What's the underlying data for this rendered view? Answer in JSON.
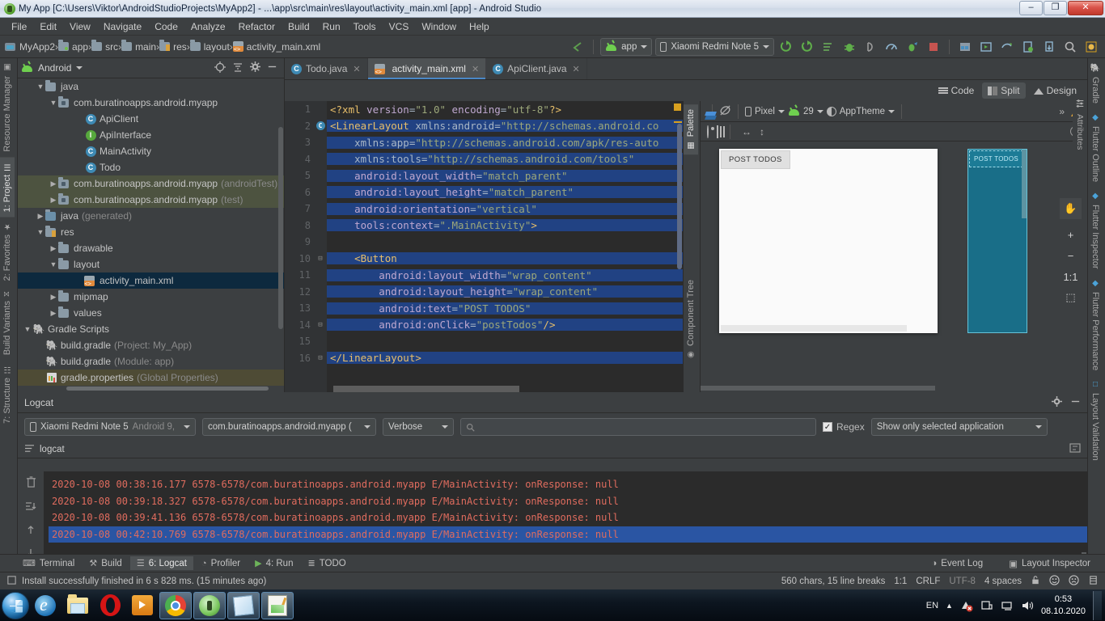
{
  "window": {
    "title": "My App [C:\\Users\\Viktor\\AndroidStudioProjects\\MyApp2] - ...\\app\\src\\main\\res\\layout\\activity_main.xml [app] - Android Studio",
    "minimize": "–",
    "maximize": "❐",
    "close": "✕"
  },
  "menu": [
    "File",
    "Edit",
    "View",
    "Navigate",
    "Code",
    "Analyze",
    "Refactor",
    "Build",
    "Run",
    "Tools",
    "VCS",
    "Window",
    "Help"
  ],
  "breadcrumb": [
    {
      "label": "MyApp2",
      "icon": "project-icon"
    },
    {
      "label": "app",
      "icon": "module-folder-icon"
    },
    {
      "label": "src",
      "icon": "folder-icon"
    },
    {
      "label": "main",
      "icon": "folder-icon"
    },
    {
      "label": "res",
      "icon": "res-folder-icon"
    },
    {
      "label": "layout",
      "icon": "folder-icon"
    },
    {
      "label": "activity_main.xml",
      "icon": "xml-file-icon"
    }
  ],
  "toolbar": {
    "back_arrow": "↖",
    "run_config": "app",
    "device": "Xiaomi Redmi Note 5",
    "icons": [
      "run-icon",
      "debug-with-coverage-icon",
      "apply-changes-icon",
      "debug-icon",
      "attach-debugger-icon",
      "profiler-icon",
      "run-profile-icon",
      "stop-icon",
      "sdk-manager-icon",
      "avd-manager-icon",
      "sync-gradle-icon",
      "layout-inspector-icon",
      "device-file-explorer-icon",
      "search-everywhere-icon",
      "settings-icon"
    ]
  },
  "left_strip": [
    "Resource Manager",
    "1: Project",
    "2: Favorites",
    "Build Variants",
    "7: Structure"
  ],
  "right_strip": [
    "Gradle",
    "Flutter Outline",
    "Flutter Inspector",
    "Flutter Performance",
    "Layout Validation"
  ],
  "project_panel": {
    "title": "Android",
    "caret": "▾",
    "actions": [
      "locate-icon",
      "collapse-all-icon",
      "settings-icon",
      "hide-icon"
    ],
    "tree": [
      {
        "depth": 1,
        "arrow": "▼",
        "icon": "folder-icon",
        "label": "java",
        "suffix": "",
        "state": "normal"
      },
      {
        "depth": 2,
        "arrow": "▼",
        "icon": "package-icon",
        "label": "com.buratinoapps.android.myapp",
        "suffix": "",
        "state": "normal"
      },
      {
        "depth": 4,
        "arrow": "",
        "icon": "class-icon",
        "label": "ApiClient",
        "suffix": "",
        "state": "normal"
      },
      {
        "depth": 4,
        "arrow": "",
        "icon": "interface-icon",
        "label": "ApiInterface",
        "suffix": "",
        "state": "normal"
      },
      {
        "depth": 4,
        "arrow": "",
        "icon": "class-icon",
        "label": "MainActivity",
        "suffix": "",
        "state": "normal"
      },
      {
        "depth": 4,
        "arrow": "",
        "icon": "class-icon",
        "label": "Todo",
        "suffix": "",
        "state": "normal"
      },
      {
        "depth": 2,
        "arrow": "▶",
        "icon": "package-icon",
        "label": "com.buratinoapps.android.myapp",
        "suffix": "(androidTest)",
        "state": "green"
      },
      {
        "depth": 2,
        "arrow": "▶",
        "icon": "package-icon",
        "label": "com.buratinoapps.android.myapp",
        "suffix": "(test)",
        "state": "green"
      },
      {
        "depth": 1,
        "arrow": "▶",
        "icon": "generated-folder-icon",
        "label": "java",
        "suffix": "(generated)",
        "state": "normal"
      },
      {
        "depth": 1,
        "arrow": "▼",
        "icon": "res-folder-icon",
        "label": "res",
        "suffix": "",
        "state": "normal"
      },
      {
        "depth": 2,
        "arrow": "▶",
        "icon": "folder-icon",
        "label": "drawable",
        "suffix": "",
        "state": "normal"
      },
      {
        "depth": 2,
        "arrow": "▼",
        "icon": "folder-icon",
        "label": "layout",
        "suffix": "",
        "state": "normal"
      },
      {
        "depth": 4,
        "arrow": "",
        "icon": "xml-file-icon",
        "label": "activity_main.xml",
        "suffix": "",
        "state": "selected"
      },
      {
        "depth": 2,
        "arrow": "▶",
        "icon": "folder-icon",
        "label": "mipmap",
        "suffix": "",
        "state": "normal"
      },
      {
        "depth": 2,
        "arrow": "▶",
        "icon": "folder-icon",
        "label": "values",
        "suffix": "",
        "state": "normal"
      },
      {
        "depth": 0,
        "arrow": "▼",
        "icon": "gradle-icon",
        "label": "Gradle Scripts",
        "suffix": "",
        "state": "normal"
      },
      {
        "depth": 1,
        "arrow": "",
        "icon": "gradle-icon",
        "label": "build.gradle",
        "suffix": "(Project: My_App)",
        "state": "normal"
      },
      {
        "depth": 1,
        "arrow": "",
        "icon": "gradle-icon",
        "label": "build.gradle",
        "suffix": "(Module: app)",
        "state": "normal"
      },
      {
        "depth": 1,
        "arrow": "",
        "icon": "properties-icon",
        "label": "gradle.properties",
        "suffix": "(Global Properties)",
        "state": "olive"
      }
    ]
  },
  "editor": {
    "tabs": [
      {
        "label": "Todo.java",
        "icon": "class-icon",
        "active": false
      },
      {
        "label": "activity_main.xml",
        "icon": "xml-file-icon",
        "active": true
      },
      {
        "label": "ApiClient.java",
        "icon": "class-icon",
        "active": false
      }
    ],
    "view_modes": [
      {
        "label": "Code",
        "icon": "code-view-icon",
        "active": false
      },
      {
        "label": "Split",
        "icon": "split-view-icon",
        "active": true
      },
      {
        "label": "Design",
        "icon": "design-view-icon",
        "active": false
      }
    ],
    "code_lines": [
      {
        "num": "1",
        "mark": "",
        "segments": [
          {
            "t": "<?xml ",
            "c": "tag"
          },
          {
            "t": "version",
            "c": "attr"
          },
          {
            "t": "=",
            "c": "punc"
          },
          {
            "t": "\"1.0\"",
            "c": "strv"
          },
          {
            "t": " encoding",
            "c": "attr"
          },
          {
            "t": "=",
            "c": "punc"
          },
          {
            "t": "\"utf-8\"",
            "c": "strv"
          },
          {
            "t": "?>",
            "c": "tag"
          }
        ]
      },
      {
        "num": "2",
        "mark": "C",
        "segments": [
          {
            "t": "<LinearLayout ",
            "c": "tag"
          },
          {
            "t": "xmlns:android",
            "c": "plain"
          },
          {
            "t": "=",
            "c": "punc"
          },
          {
            "t": "\"http://schemas.android.co",
            "c": "strv"
          }
        ]
      },
      {
        "num": "3",
        "mark": "",
        "segments": [
          {
            "t": "    xmlns:app",
            "c": "plain"
          },
          {
            "t": "=",
            "c": "punc"
          },
          {
            "t": "\"http://schemas.android.com/apk/res-auto",
            "c": "strv"
          }
        ]
      },
      {
        "num": "4",
        "mark": "",
        "segments": [
          {
            "t": "    xmlns:tools",
            "c": "plain"
          },
          {
            "t": "=",
            "c": "punc"
          },
          {
            "t": "\"http://schemas.android.com/tools\"",
            "c": "strv"
          }
        ]
      },
      {
        "num": "5",
        "mark": "",
        "segments": [
          {
            "t": "    android:layout_width",
            "c": "attr"
          },
          {
            "t": "=",
            "c": "punc"
          },
          {
            "t": "\"match_parent\"",
            "c": "strv"
          }
        ]
      },
      {
        "num": "6",
        "mark": "",
        "segments": [
          {
            "t": "    android:layout_height",
            "c": "attr"
          },
          {
            "t": "=",
            "c": "punc"
          },
          {
            "t": "\"match_parent\"",
            "c": "strv"
          }
        ]
      },
      {
        "num": "7",
        "mark": "",
        "segments": [
          {
            "t": "    android:orientation",
            "c": "attr"
          },
          {
            "t": "=",
            "c": "punc"
          },
          {
            "t": "\"vertical\"",
            "c": "strv"
          }
        ]
      },
      {
        "num": "8",
        "mark": "",
        "segments": [
          {
            "t": "    tools:context",
            "c": "attr"
          },
          {
            "t": "=",
            "c": "punc"
          },
          {
            "t": "\".MainActivity\"",
            "c": "strv"
          },
          {
            "t": ">",
            "c": "tag"
          }
        ]
      },
      {
        "num": "9",
        "mark": "",
        "segments": []
      },
      {
        "num": "10",
        "mark": "-",
        "segments": [
          {
            "t": "    <Button",
            "c": "tag"
          }
        ]
      },
      {
        "num": "11",
        "mark": "",
        "segments": [
          {
            "t": "        android:layout_width",
            "c": "attr"
          },
          {
            "t": "=",
            "c": "punc"
          },
          {
            "t": "\"wrap_content\"",
            "c": "strv"
          }
        ]
      },
      {
        "num": "12",
        "mark": "",
        "segments": [
          {
            "t": "        android:layout_height",
            "c": "attr"
          },
          {
            "t": "=",
            "c": "punc"
          },
          {
            "t": "\"wrap_content\"",
            "c": "strv"
          }
        ]
      },
      {
        "num": "13",
        "mark": "",
        "segments": [
          {
            "t": "        android:text",
            "c": "attr"
          },
          {
            "t": "=",
            "c": "punc"
          },
          {
            "t": "\"POST TODOS\"",
            "c": "strv"
          }
        ]
      },
      {
        "num": "14",
        "mark": "-",
        "segments": [
          {
            "t": "        android:onClick",
            "c": "attr"
          },
          {
            "t": "=",
            "c": "punc"
          },
          {
            "t": "\"postTodos\"",
            "c": "strv"
          },
          {
            "t": "/>",
            "c": "tag"
          }
        ]
      },
      {
        "num": "15",
        "mark": "",
        "segments": []
      },
      {
        "num": "16",
        "mark": "-",
        "segments": [
          {
            "t": "</LinearLayout>",
            "c": "tag"
          }
        ]
      }
    ],
    "palette_label": "Palette",
    "component_tree_label": "Component Tree",
    "attributes_label": "Attributes"
  },
  "design": {
    "surface_label": "",
    "device_name": "Pixel",
    "api_level": "29",
    "theme": "AppTheme",
    "overflow": "»",
    "warning_icon": "warning-icon",
    "preview_button_text": "POST TODOS",
    "blueprint_button_text": "POST TODOS",
    "zoom_controls": [
      {
        "label": "✋",
        "name": "pan-tool-button"
      },
      {
        "label": "+",
        "name": "zoom-in-button"
      },
      {
        "label": "−",
        "name": "zoom-out-button"
      },
      {
        "label": "1:1",
        "name": "zoom-actual-button"
      },
      {
        "label": "⬚",
        "name": "zoom-to-fit-button"
      }
    ]
  },
  "logcat": {
    "title": "Logcat",
    "device": "Xiaomi Redmi Note 5",
    "device_meta": "Android 9,",
    "process": "com.buratinoapps.android.myapp (",
    "level": "Verbose",
    "search_placeholder": "",
    "regex_label": "Regex",
    "regex_checked": "✓",
    "filter": "Show only selected application",
    "tab_label": "logcat",
    "lines": [
      {
        "text": "2020-10-08 00:38:16.177 6578-6578/com.buratinoapps.android.myapp E/MainActivity: onResponse: null",
        "selected": false
      },
      {
        "text": "2020-10-08 00:39:18.327 6578-6578/com.buratinoapps.android.myapp E/MainActivity: onResponse: null",
        "selected": false
      },
      {
        "text": "2020-10-08 00:39:41.136 6578-6578/com.buratinoapps.android.myapp E/MainActivity: onResponse: null",
        "selected": false
      },
      {
        "text": "2020-10-08 00:42:10.769 6578-6578/com.buratinoapps.android.myapp E/MainActivity: onResponse: null",
        "selected": true
      }
    ]
  },
  "bottom_tabs": [
    {
      "label": "Terminal",
      "icon": "terminal-icon",
      "active": false
    },
    {
      "label": "Build",
      "icon": "build-hammer-icon",
      "active": false
    },
    {
      "label": "6: Logcat",
      "icon": "logcat-icon",
      "active": true
    },
    {
      "label": "Profiler",
      "icon": "profiler-icon",
      "active": false
    },
    {
      "label": "4: Run",
      "icon": "run-icon",
      "active": false
    },
    {
      "label": "TODO",
      "icon": "todo-icon",
      "active": false
    }
  ],
  "bottom_right_tabs": [
    {
      "label": "Event Log",
      "icon": "event-log-icon"
    },
    {
      "label": "Layout Inspector",
      "icon": "layout-inspector-icon"
    }
  ],
  "status": {
    "message": "Install successfully finished in 6 s 828 ms. (15 minutes ago)",
    "chars": "560 chars, 15 line breaks",
    "caret": "1:1",
    "line_sep": "CRLF",
    "encoding": "UTF-8",
    "indent": "4 spaces",
    "icons": [
      "lock-icon",
      "happy-face-icon",
      "sad-face-icon",
      "memory-icon"
    ]
  },
  "taskbar": {
    "start_label": "start-orb",
    "items": [
      {
        "name": "internet-explorer-icon",
        "pinned": false
      },
      {
        "name": "file-explorer-icon",
        "pinned": false
      },
      {
        "name": "opera-icon",
        "pinned": false
      },
      {
        "name": "windows-media-player-icon",
        "pinned": false
      },
      {
        "name": "chrome-window-icon",
        "pinned": true
      },
      {
        "name": "android-studio-window-icon",
        "pinned": true
      },
      {
        "name": "notepad-window-icon",
        "pinned": true
      },
      {
        "name": "notepadpp-window-icon",
        "pinned": true
      }
    ],
    "language": "EN",
    "tray_icons": [
      "show-hidden-icon",
      "network-error-icon",
      "action-center-icon",
      "display-icon",
      "volume-icon"
    ],
    "time": "0:53",
    "date": "08.10.2020"
  }
}
